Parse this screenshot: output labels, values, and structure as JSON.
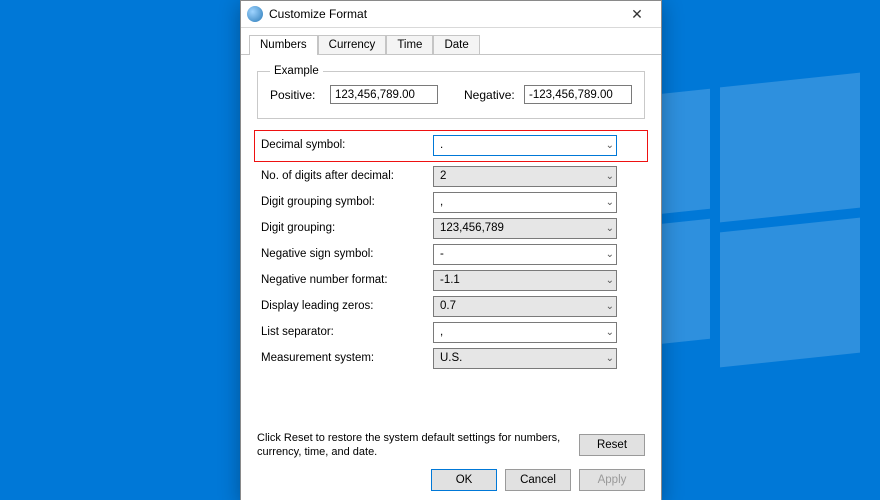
{
  "window": {
    "title": "Customize Format"
  },
  "tabs": {
    "t0": "Numbers",
    "t1": "Currency",
    "t2": "Time",
    "t3": "Date"
  },
  "example": {
    "legend": "Example",
    "pos_label": "Positive:",
    "pos_value": "123,456,789.00",
    "neg_label": "Negative:",
    "neg_value": "-123,456,789.00"
  },
  "fields": {
    "decimal_symbol": {
      "label": "Decimal symbol:",
      "value": "."
    },
    "digits_after": {
      "label": "No. of digits after decimal:",
      "value": "2"
    },
    "grouping_symbol": {
      "label": "Digit grouping symbol:",
      "value": ","
    },
    "digit_grouping": {
      "label": "Digit grouping:",
      "value": "123,456,789"
    },
    "negative_sign": {
      "label": "Negative sign symbol:",
      "value": "-"
    },
    "negative_format": {
      "label": "Negative number format:",
      "value": "-1.1"
    },
    "leading_zeros": {
      "label": "Display leading zeros:",
      "value": "0.7"
    },
    "list_separator": {
      "label": "List separator:",
      "value": ","
    },
    "measurement": {
      "label": "Measurement system:",
      "value": "U.S."
    }
  },
  "footer": {
    "reset_hint": "Click Reset to restore the system default settings for numbers, currency, time, and date.",
    "reset": "Reset"
  },
  "buttons": {
    "ok": "OK",
    "cancel": "Cancel",
    "apply": "Apply"
  }
}
